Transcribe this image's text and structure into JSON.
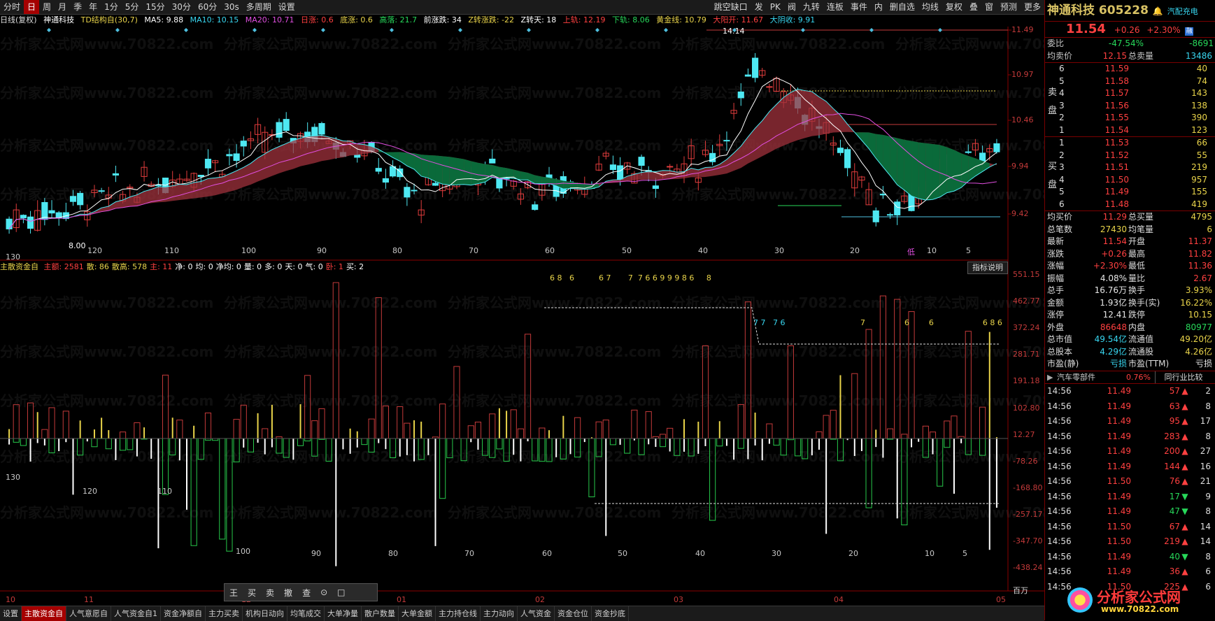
{
  "toolbar": {
    "items": [
      "分时",
      "日",
      "周",
      "月",
      "季",
      "年",
      "1分",
      "5分",
      "15分",
      "30分",
      "60分",
      "30s",
      "多周期",
      "设置"
    ],
    "active_index": 1,
    "right_items": [
      "跳空缺口",
      "发",
      "PK",
      "阀",
      "九转",
      "连板",
      "事件",
      "内",
      "删自选",
      "均线",
      "复权",
      "叠",
      "窗",
      "预测",
      "更多"
    ]
  },
  "infobar": {
    "period": "日线(复权)",
    "stock": "神通科技",
    "td": "TD结构自(30,7)",
    "ma5": "MA5: 9.88",
    "ma10": "MA10: 10.15",
    "ma20": "MA20: 10.71",
    "rz": "日涨: 0.6",
    "dz": "底涨: 0.6",
    "gl": "高落: 21.7",
    "qz": "前涨跌: 34",
    "zz": "Z转涨跌: -22",
    "zt": "Z转天: 18",
    "sg": "上轨: 12.19",
    "xg": "下轨: 8.06",
    "hj": "黄金线: 10.79",
    "dyk": "大阳开: 11.67",
    "dys": "大阴收: 9.91"
  },
  "main_chart": {
    "y_ticks": [
      "11.49",
      "10.97",
      "10.46",
      "9.94",
      "9.42"
    ],
    "x_labels": [
      "130",
      "120",
      "110",
      "100",
      "90",
      "80",
      "70",
      "60",
      "50",
      "40",
      "30",
      "20",
      "10",
      "5"
    ],
    "high_label": "14.14",
    "low_label": "8.00",
    "low_marker": "低"
  },
  "indicator": {
    "title_bar": "主散资金自",
    "stats": [
      "主额: 2581",
      "散: 86",
      "散高: 578",
      "主: 11",
      "净: 0",
      "均: 0",
      "净均: 0",
      "量: 0",
      "多: 0",
      "天: 0",
      "气: 0",
      "卧: 1",
      "买: 2"
    ],
    "explain_btn": "指标说明",
    "y_ticks": [
      "551.15",
      "462.77",
      "372.24",
      "281.71",
      "191.18",
      "102.80",
      "12.27",
      "-78.26",
      "-168.80",
      "-257.17",
      "-347.70",
      "-438.24"
    ],
    "unit": "百万",
    "digits_top": "6 8   6          6 7       7  7 6 6 9 9 9 8 6     8",
    "digits_mid": "7 7   7 6",
    "digits_right": "7                6        6                    6 8 6",
    "x_labels": [
      "130",
      "120",
      "110",
      "100",
      "90",
      "80",
      "70",
      "60",
      "50",
      "40",
      "30",
      "20",
      "10",
      "5"
    ]
  },
  "month_labels": [
    "10",
    "11",
    "12",
    "01",
    "02",
    "03",
    "04",
    "05"
  ],
  "bottom_tabs": [
    "设置",
    "主散资金自",
    "人气意愿自",
    "人气资金自1",
    "资金净额自",
    "主力买卖",
    "机构日动向",
    "均笔成交",
    "大单净量",
    "散户数量",
    "大单金额",
    "主力持仓线",
    "主力动向",
    "人气资金",
    "资金仓位",
    "资金抄底"
  ],
  "active_tab": 1,
  "float_toolbar": [
    "王",
    "买",
    "卖",
    "撤",
    "查",
    "⊙",
    "□"
  ],
  "right_panel": {
    "name": "神通科技",
    "code": "605228",
    "sector_tag": "汽配充电",
    "price": "11.54",
    "change": "+0.26",
    "pct": "+2.30%",
    "ratio_label": "委比",
    "ratio_value": "-47.54%",
    "ratio_diff": "-8691",
    "avg_label": "均卖价",
    "avg_value": "12.15",
    "total_sell_label": "总卖量",
    "total_sell_value": "13486",
    "sell_title": "卖盘",
    "buy_title": "买盘",
    "sells": [
      {
        "lvl": "6",
        "price": "11.59",
        "vol": "40"
      },
      {
        "lvl": "5",
        "price": "11.58",
        "vol": "74"
      },
      {
        "lvl": "4",
        "price": "11.57",
        "vol": "143"
      },
      {
        "lvl": "3",
        "price": "11.56",
        "vol": "138"
      },
      {
        "lvl": "2",
        "price": "11.55",
        "vol": "390"
      },
      {
        "lvl": "1",
        "price": "11.54",
        "vol": "123"
      }
    ],
    "buys": [
      {
        "lvl": "1",
        "price": "11.53",
        "vol": "66"
      },
      {
        "lvl": "2",
        "price": "11.52",
        "vol": "55"
      },
      {
        "lvl": "3",
        "price": "11.51",
        "vol": "219"
      },
      {
        "lvl": "4",
        "price": "11.50",
        "vol": "957"
      },
      {
        "lvl": "5",
        "price": "11.49",
        "vol": "155"
      },
      {
        "lvl": "6",
        "price": "11.48",
        "vol": "419"
      }
    ],
    "stats": [
      [
        "均买价",
        "11.29",
        "总买量",
        "4795"
      ],
      [
        "总笔数",
        "27430",
        "均笔量",
        "6"
      ],
      [
        "最新",
        "11.54",
        "开盘",
        "11.37"
      ],
      [
        "涨跌",
        "+0.26",
        "最高",
        "11.82"
      ],
      [
        "涨幅",
        "+2.30%",
        "最低",
        "11.36"
      ],
      [
        "振幅",
        "4.08%",
        "量比",
        "2.67"
      ],
      [
        "总手",
        "16.76万",
        "换手",
        "3.93%"
      ],
      [
        "金额",
        "1.93亿",
        "换手(实)",
        "16.22%"
      ],
      [
        "涨停",
        "12.41",
        "跌停",
        "10.15"
      ],
      [
        "外盘",
        "86648",
        "内盘",
        "80977"
      ],
      [
        "总市值",
        "49.54亿",
        "流通值",
        "49.20亿"
      ],
      [
        "总股本",
        "4.29亿",
        "流通股",
        "4.26亿"
      ],
      [
        "市盈(静)",
        "亏损",
        "市盈(TTM)",
        "亏损"
      ]
    ],
    "industry": "汽车零部件",
    "industry_pct": "0.76%",
    "industry_btn": "同行业比较",
    "ticks": [
      [
        "14:56",
        "11.49",
        "57",
        "2"
      ],
      [
        "14:56",
        "11.49",
        "63",
        "8"
      ],
      [
        "14:56",
        "11.49",
        "95",
        "17"
      ],
      [
        "14:56",
        "11.49",
        "283",
        "8"
      ],
      [
        "14:56",
        "11.49",
        "200",
        "27"
      ],
      [
        "14:56",
        "11.49",
        "144",
        "16"
      ],
      [
        "14:56",
        "11.50",
        "76",
        "21"
      ],
      [
        "14:56",
        "11.49",
        "17",
        "9"
      ],
      [
        "14:56",
        "11.49",
        "47",
        "8"
      ],
      [
        "14:56",
        "11.50",
        "67",
        "14"
      ],
      [
        "14:56",
        "11.50",
        "219",
        "14"
      ],
      [
        "14:56",
        "11.49",
        "40",
        "8"
      ],
      [
        "14:56",
        "11.49",
        "36",
        "6"
      ],
      [
        "14:56",
        "11.50",
        "225",
        "6"
      ]
    ],
    "tick_dirs": [
      "up",
      "up",
      "up",
      "up",
      "up",
      "up",
      "up",
      "down",
      "down",
      "up",
      "up",
      "down",
      "up",
      "up"
    ],
    "logo_text": "分析家公式网",
    "logo_url": "www.70822.com"
  },
  "watermark": "分析家公式网www.70822.com"
}
